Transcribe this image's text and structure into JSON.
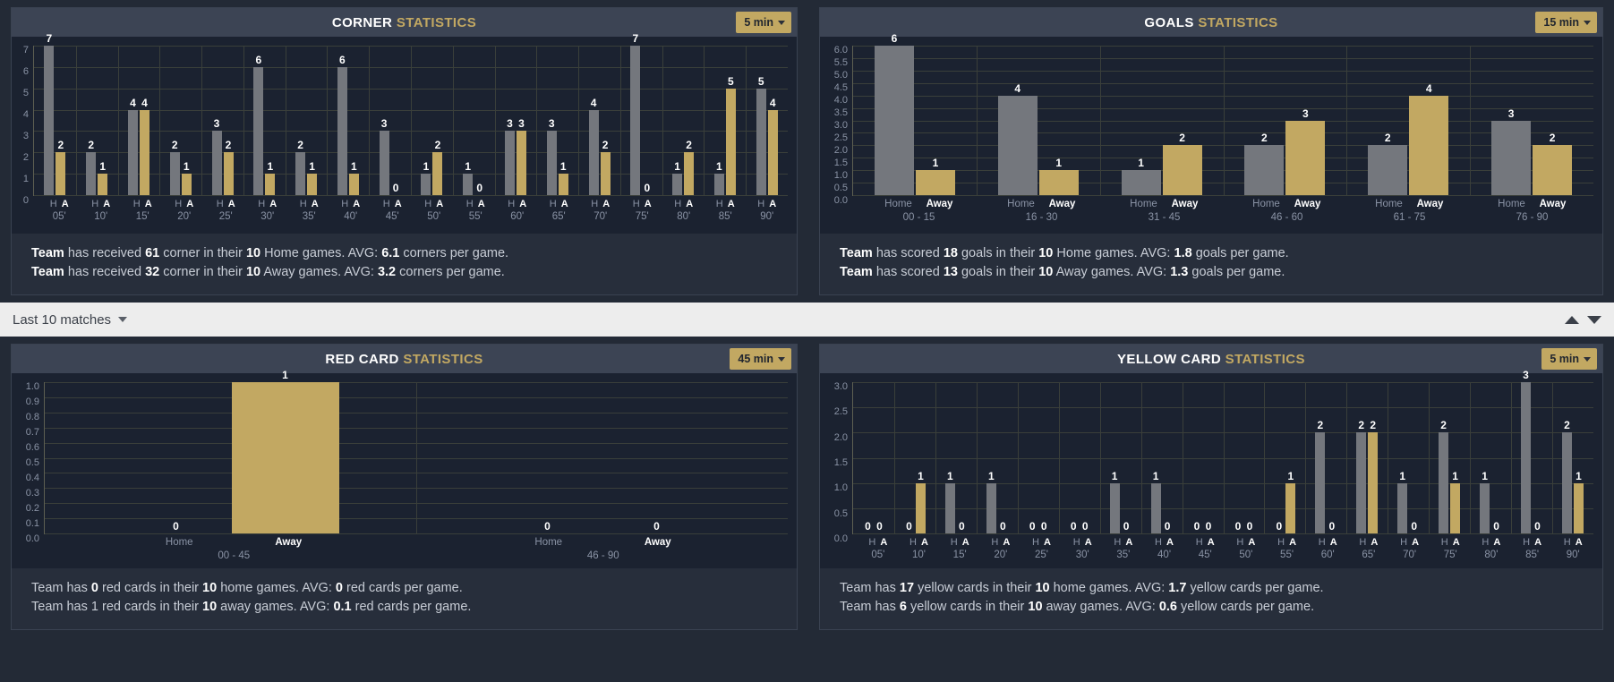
{
  "colors": {
    "home_bar": "#74777d",
    "away_bar": "#c2a862",
    "accent_gold": "#c2a862",
    "panel_bg": "#272e3b",
    "plot_bg": "#1b2230",
    "header_bg": "#3c4454"
  },
  "filter_bar": {
    "label": "Last 10 matches",
    "caret_icon": "chevron-down-icon",
    "collapse_icon": "triangle-up-icon",
    "expand_icon": "triangle-down-icon"
  },
  "panels": {
    "corner": {
      "title_bold": "CORNER",
      "title_light": "STATISTICS",
      "period": "5 min",
      "footer": [
        {
          "parts": [
            {
              "t": "Team",
              "b": true
            },
            {
              "t": " has received ",
              "b": false
            },
            {
              "t": "61",
              "b": true
            },
            {
              "t": " corner in their ",
              "b": false
            },
            {
              "t": "10",
              "b": true
            },
            {
              "t": " Home games. AVG: ",
              "b": false
            },
            {
              "t": "6.1",
              "b": true
            },
            {
              "t": " corners per game.",
              "b": false
            }
          ]
        },
        {
          "parts": [
            {
              "t": "Team",
              "b": true
            },
            {
              "t": " has received ",
              "b": false
            },
            {
              "t": "32",
              "b": true
            },
            {
              "t": " corner in their ",
              "b": false
            },
            {
              "t": "10",
              "b": true
            },
            {
              "t": " Away games. AVG: ",
              "b": false
            },
            {
              "t": "3.2",
              "b": true
            },
            {
              "t": " corners per game.",
              "b": false
            }
          ]
        }
      ]
    },
    "goals": {
      "title_bold": "GOALS",
      "title_light": "STATISTICS",
      "period": "15 min",
      "footer": [
        {
          "parts": [
            {
              "t": "Team",
              "b": true
            },
            {
              "t": " has scored ",
              "b": false
            },
            {
              "t": "18",
              "b": true
            },
            {
              "t": " goals in their ",
              "b": false
            },
            {
              "t": "10",
              "b": true
            },
            {
              "t": " Home games. AVG: ",
              "b": false
            },
            {
              "t": "1.8",
              "b": true
            },
            {
              "t": " goals per game.",
              "b": false
            }
          ]
        },
        {
          "parts": [
            {
              "t": "Team",
              "b": true
            },
            {
              "t": " has scored ",
              "b": false
            },
            {
              "t": "13",
              "b": true
            },
            {
              "t": " goals in their ",
              "b": false
            },
            {
              "t": "10",
              "b": true
            },
            {
              "t": " Away games. AVG: ",
              "b": false
            },
            {
              "t": "1.3",
              "b": true
            },
            {
              "t": " goals per game.",
              "b": false
            }
          ]
        }
      ]
    },
    "redcard": {
      "title_bold": "RED CARD",
      "title_light": "STATISTICS",
      "period": "45 min",
      "footer": [
        {
          "parts": [
            {
              "t": "Team has ",
              "b": false
            },
            {
              "t": "0",
              "b": true
            },
            {
              "t": " red cards in their ",
              "b": false
            },
            {
              "t": "10",
              "b": true
            },
            {
              "t": " home games. AVG: ",
              "b": false
            },
            {
              "t": "0",
              "b": true
            },
            {
              "t": " red cards per game.",
              "b": false
            }
          ]
        },
        {
          "parts": [
            {
              "t": "Team has 1 red cards in their ",
              "b": false
            },
            {
              "t": "10",
              "b": true
            },
            {
              "t": " away games. AVG: ",
              "b": false
            },
            {
              "t": "0.1",
              "b": true
            },
            {
              "t": " red cards per game.",
              "b": false
            }
          ]
        }
      ]
    },
    "yellowcard": {
      "title_bold": "YELLOW CARD",
      "title_light": "STATISTICS",
      "period": "5 min",
      "footer": [
        {
          "parts": [
            {
              "t": "Team has ",
              "b": false
            },
            {
              "t": "17",
              "b": true
            },
            {
              "t": " yellow cards in their ",
              "b": false
            },
            {
              "t": "10",
              "b": true
            },
            {
              "t": " home games. AVG: ",
              "b": false
            },
            {
              "t": "1.7",
              "b": true
            },
            {
              "t": " yellow cards per game.",
              "b": false
            }
          ]
        },
        {
          "parts": [
            {
              "t": "Team has ",
              "b": false
            },
            {
              "t": "6",
              "b": true
            },
            {
              "t": " yellow cards in their ",
              "b": false
            },
            {
              "t": "10",
              "b": true
            },
            {
              "t": " away games. AVG: ",
              "b": false
            },
            {
              "t": "0.6",
              "b": true
            },
            {
              "t": " yellow cards per game.",
              "b": false
            }
          ]
        }
      ]
    }
  },
  "chart_data": [
    {
      "id": "corner",
      "type": "bar",
      "title": "CORNER STATISTICS",
      "xlabel": "",
      "ylabel": "",
      "ylim": [
        0,
        7
      ],
      "yticks": [
        7,
        6,
        5,
        4,
        3,
        2,
        1,
        0
      ],
      "grid": true,
      "legend": [
        "H",
        "A"
      ],
      "group_sub_labels": [
        "H",
        "A"
      ],
      "categories": [
        "05'",
        "10'",
        "15'",
        "20'",
        "25'",
        "30'",
        "35'",
        "40'",
        "45'",
        "50'",
        "55'",
        "60'",
        "65'",
        "70'",
        "75'",
        "80'",
        "85'",
        "90'"
      ],
      "series": [
        {
          "name": "H",
          "color": "#74777d",
          "values": [
            7,
            2,
            4,
            2,
            3,
            6,
            2,
            6,
            3,
            1,
            1,
            3,
            3,
            4,
            7,
            1,
            1,
            5
          ]
        },
        {
          "name": "A",
          "color": "#c2a862",
          "values": [
            2,
            1,
            4,
            1,
            2,
            1,
            1,
            1,
            0,
            2,
            0,
            3,
            1,
            2,
            0,
            2,
            5,
            4
          ]
        }
      ]
    },
    {
      "id": "goals",
      "type": "bar",
      "title": "GOALS STATISTICS",
      "xlabel": "",
      "ylabel": "",
      "ylim": [
        0,
        6
      ],
      "yticks": [
        "6.0",
        "5.5",
        "5.0",
        "4.5",
        "4.0",
        "3.5",
        "3.0",
        "2.5",
        "2.0",
        "1.5",
        "1.0",
        "0.5",
        "0.0"
      ],
      "grid": true,
      "legend": [
        "Home",
        "Away"
      ],
      "group_sub_labels": [
        "Home",
        "Away"
      ],
      "categories": [
        "00 - 15",
        "16 - 30",
        "31 - 45",
        "46 - 60",
        "61 - 75",
        "76 - 90"
      ],
      "series": [
        {
          "name": "Home",
          "color": "#74777d",
          "values": [
            6,
            4,
            1,
            2,
            2,
            3
          ]
        },
        {
          "name": "Away",
          "color": "#c2a862",
          "values": [
            1,
            1,
            2,
            3,
            4,
            2
          ]
        }
      ]
    },
    {
      "id": "redcard",
      "type": "bar",
      "title": "RED CARD STATISTICS",
      "xlabel": "",
      "ylabel": "",
      "ylim": [
        0,
        1
      ],
      "yticks": [
        "1.0",
        "0.9",
        "0.8",
        "0.7",
        "0.6",
        "0.5",
        "0.4",
        "0.3",
        "0.2",
        "0.1",
        "0.0"
      ],
      "grid": true,
      "legend": [
        "Home",
        "Away"
      ],
      "group_sub_labels": [
        "Home",
        "Away"
      ],
      "categories": [
        "00 - 45",
        "46 - 90"
      ],
      "series": [
        {
          "name": "Home",
          "color": "#74777d",
          "values": [
            0,
            0
          ]
        },
        {
          "name": "Away",
          "color": "#c2a862",
          "values": [
            1,
            0
          ]
        }
      ]
    },
    {
      "id": "yellowcard",
      "type": "bar",
      "title": "YELLOW CARD STATISTICS",
      "xlabel": "",
      "ylabel": "",
      "ylim": [
        0,
        3
      ],
      "yticks": [
        "3.0",
        "2.5",
        "2.0",
        "1.5",
        "1.0",
        "0.5",
        "0.0"
      ],
      "grid": true,
      "legend": [
        "H",
        "A"
      ],
      "group_sub_labels": [
        "H",
        "A"
      ],
      "categories": [
        "05'",
        "10'",
        "15'",
        "20'",
        "25'",
        "30'",
        "35'",
        "40'",
        "45'",
        "50'",
        "55'",
        "60'",
        "65'",
        "70'",
        "75'",
        "80'",
        "85'",
        "90'"
      ],
      "series": [
        {
          "name": "H",
          "color": "#74777d",
          "values": [
            0,
            0,
            1,
            1,
            0,
            0,
            1,
            1,
            0,
            0,
            0,
            2,
            2,
            1,
            2,
            1,
            3,
            2
          ]
        },
        {
          "name": "A",
          "color": "#c2a862",
          "values": [
            0,
            1,
            0,
            0,
            0,
            0,
            0,
            0,
            0,
            0,
            1,
            0,
            2,
            0,
            1,
            0,
            0,
            1
          ]
        }
      ]
    }
  ]
}
